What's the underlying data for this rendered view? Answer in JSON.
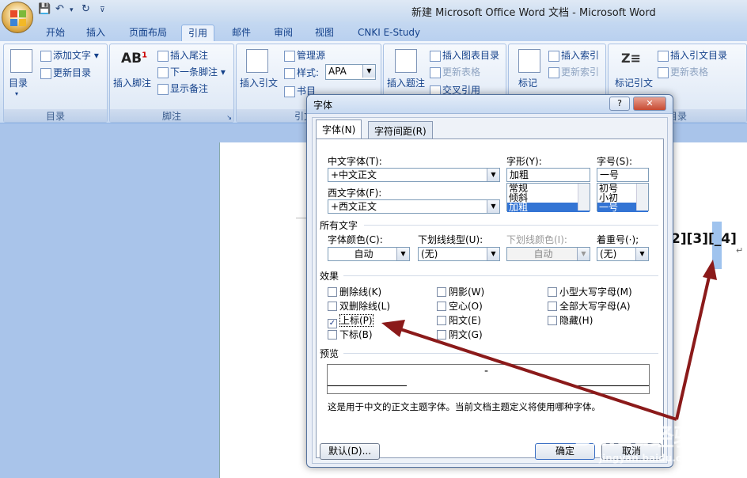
{
  "window": {
    "title": "新建 Microsoft Office Word 文档 - Microsoft Word"
  },
  "ribbon_tabs": [
    "开始",
    "插入",
    "页面布局",
    "引用",
    "邮件",
    "审阅",
    "视图",
    "CNKI E-Study"
  ],
  "ribbon": {
    "toc": {
      "big": "目录",
      "add_text": "添加文字",
      "update": "更新目录",
      "group": "目录"
    },
    "footnotes": {
      "insert_footnote": "插入脚注",
      "insert_endnote": "插入尾注",
      "next_footnote": "下一条脚注",
      "show_notes": "显示备注",
      "group": "脚注"
    },
    "citations": {
      "insert_citation": "插入引文",
      "manage_sources": "管理源",
      "style_label": "样式:",
      "style_value": "APA",
      "bibliography": "书目",
      "group": "引文与"
    },
    "captions": {
      "insert_caption": "插入题注",
      "insert_table_of_figures": "插入图表目录",
      "update_table": "更新表格",
      "cross_reference": "交叉引用"
    },
    "index": {
      "mark_entry": "标记",
      "insert_index": "插入索引",
      "update_index": "更新索引"
    },
    "toa": {
      "mark_citation": "标记引文",
      "insert_toa": "插入引文目录",
      "update_table": "更新表格",
      "group": "目录"
    }
  },
  "document": {
    "text": "2][3][",
    "selected": "_4]",
    "pilcrow": "↵"
  },
  "dialog": {
    "title": "字体",
    "help": "?",
    "close": "✕",
    "tabs": [
      "字体(N)",
      "字符间距(R)"
    ],
    "cn_font_label": "中文字体(T):",
    "cn_font_value": "+中文正文",
    "west_font_label": "西文字体(F):",
    "west_font_value": "+西文正文",
    "style_label": "字形(Y):",
    "style_value": "加粗",
    "style_options": [
      "常规",
      "倾斜",
      "加粗"
    ],
    "size_label": "字号(S):",
    "size_value": "一号",
    "size_options": [
      "初号",
      "小初",
      "一号"
    ],
    "all_text_label": "所有文字",
    "font_color_label": "字体颜色(C):",
    "font_color_value": "自动",
    "underline_label": "下划线线型(U):",
    "underline_value": "(无)",
    "underline_color_label": "下划线颜色(I):",
    "underline_color_value": "自动",
    "emphasis_label": "着重号(·);",
    "emphasis_value": "(无)",
    "effects_label": "效果",
    "effects": [
      {
        "label": "删除线(K)",
        "checked": false
      },
      {
        "label": "双删除线(L)",
        "checked": false
      },
      {
        "label": "上标(P)",
        "checked": true
      },
      {
        "label": "下标(B)",
        "checked": false
      },
      {
        "label": "阴影(W)",
        "checked": false
      },
      {
        "label": "空心(O)",
        "checked": false
      },
      {
        "label": "阳文(E)",
        "checked": false
      },
      {
        "label": "阴文(G)",
        "checked": false
      },
      {
        "label": "小型大写字母(M)",
        "checked": false
      },
      {
        "label": "全部大写字母(A)",
        "checked": false
      },
      {
        "label": "隐藏(H)",
        "checked": false
      }
    ],
    "preview_label": "预览",
    "preview_text": "-",
    "description": "这是用于中文的正文主题字体。当前文档主题定义将使用哪种字体。",
    "default_button": "默认(D)...",
    "ok_button": "确定",
    "cancel_button": "取消"
  },
  "watermark": {
    "brand": "Baidu经验",
    "url": "jingyan.baidu.com"
  },
  "annotation_color": "#8b1a1a"
}
